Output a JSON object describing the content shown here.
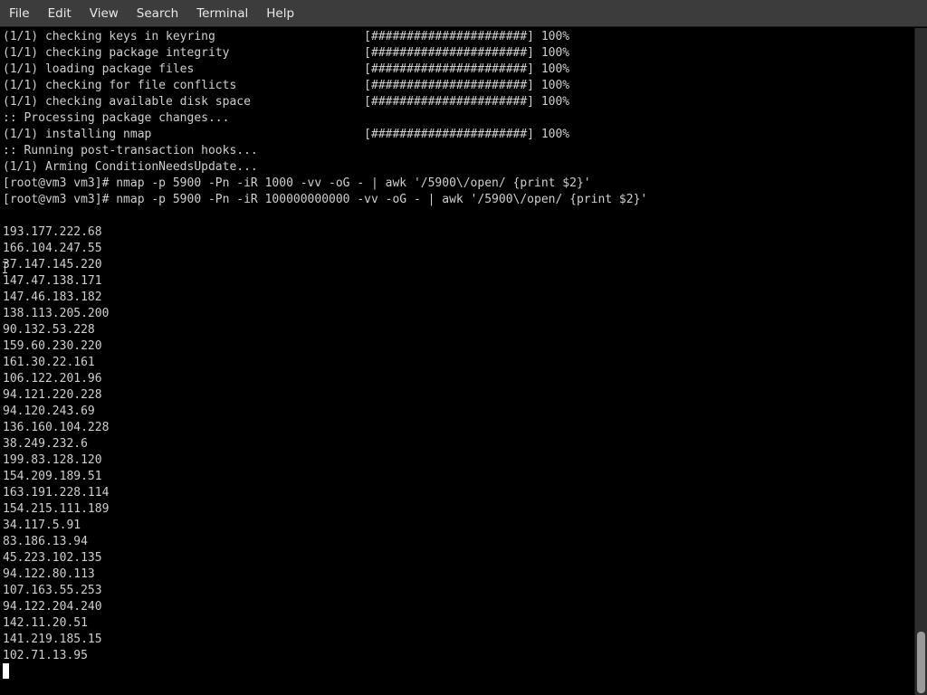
{
  "menubar": {
    "items": [
      "File",
      "Edit",
      "View",
      "Search",
      "Terminal",
      "Help"
    ]
  },
  "terminal": {
    "lines": [
      "(1/1) checking keys in keyring                     [######################] 100%",
      "(1/1) checking package integrity                   [######################] 100%",
      "(1/1) loading package files                        [######################] 100%",
      "(1/1) checking for file conflicts                  [######################] 100%",
      "(1/1) checking available disk space                [######################] 100%",
      ":: Processing package changes...",
      "(1/1) installing nmap                              [######################] 100%",
      ":: Running post-transaction hooks...",
      "(1/1) Arming ConditionNeedsUpdate...",
      "[root@vm3 vm3]# nmap -p 5900 -Pn -iR 1000 -vv -oG - | awk '/5900\\/open/ {print $2}'",
      "[root@vm3 vm3]# nmap -p 5900 -Pn -iR 100000000000 -vv -oG - | awk '/5900\\/open/ {print $2}'",
      "",
      "193.177.222.68",
      "166.104.247.55",
      "37.147.145.220",
      "147.47.138.171",
      "147.46.183.182",
      "138.113.205.200",
      "90.132.53.228",
      "159.60.230.220",
      "161.30.22.161",
      "106.122.201.96",
      "94.121.220.228",
      "94.120.243.69",
      "136.160.104.228",
      "38.249.232.6",
      "199.83.128.120",
      "154.209.189.51",
      "163.191.228.114",
      "154.215.111.189",
      "34.117.5.91",
      "83.186.13.94",
      "45.223.102.135",
      "94.122.80.113",
      "107.163.55.253",
      "94.122.204.240",
      "142.11.20.51",
      "141.219.185.15",
      "102.71.13.95"
    ]
  },
  "colors": {
    "menubar_bg": "#3c3c3c",
    "menubar_text": "#e8e8e8",
    "terminal_bg": "#000000",
    "terminal_text": "#cfcfcf",
    "cursor": "#ffffff"
  }
}
